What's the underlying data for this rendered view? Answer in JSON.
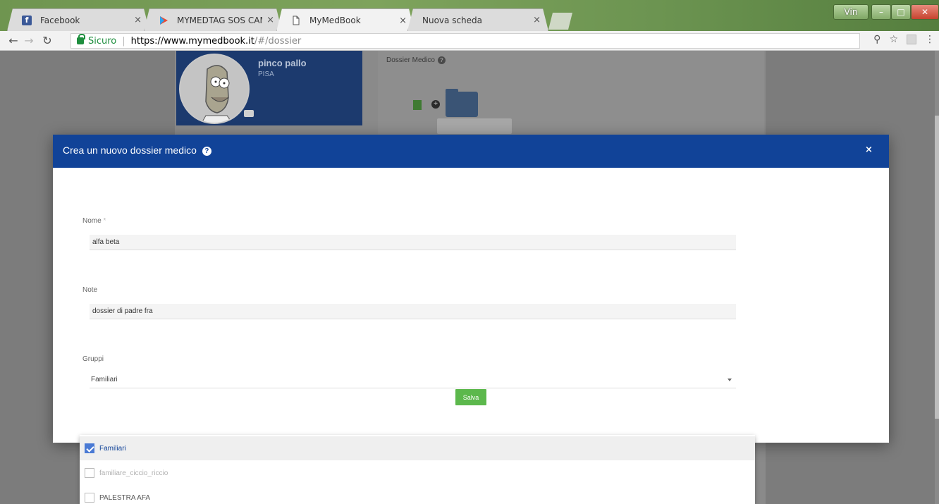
{
  "browser": {
    "tabs": [
      {
        "label": "Facebook",
        "icon": "facebook-icon"
      },
      {
        "label": "MYMEDTAG SOS CAMPI",
        "icon": "play-store-icon"
      },
      {
        "label": "MyMedBook",
        "icon": "document-icon"
      },
      {
        "label": "Nuova scheda",
        "icon": ""
      }
    ],
    "close_glyph": "×",
    "user_label": "Vin",
    "secure_label": "Sicuro",
    "url_host": "https://www.mymedbook.it",
    "url_path": "/#/dossier"
  },
  "profile": {
    "name": "pinco pallo",
    "city": "PISA"
  },
  "dossier_panel": {
    "title": "Dossier Medico"
  },
  "modal": {
    "title": "Crea un nuovo dossier medico",
    "help_glyph": "?",
    "close_glyph": "×",
    "fields": {
      "nome_label": "Nome",
      "nome_required": "*",
      "nome_value": "alfa beta",
      "note_label": "Note",
      "note_value": "dossier di padre fra",
      "gruppi_label": "Gruppi",
      "gruppi_value": "Familiari"
    },
    "save_label": "Salva"
  },
  "dropdown": {
    "options": [
      {
        "label": "Familiari",
        "checked": true
      },
      {
        "label": "familiare_ciccio_riccio",
        "checked": false
      },
      {
        "label": "PALESTRA AFA",
        "checked": false
      }
    ]
  },
  "colors": {
    "modal_header": "#114398",
    "save_button": "#5cb84c",
    "checkbox_checked": "#4a7ad4"
  }
}
